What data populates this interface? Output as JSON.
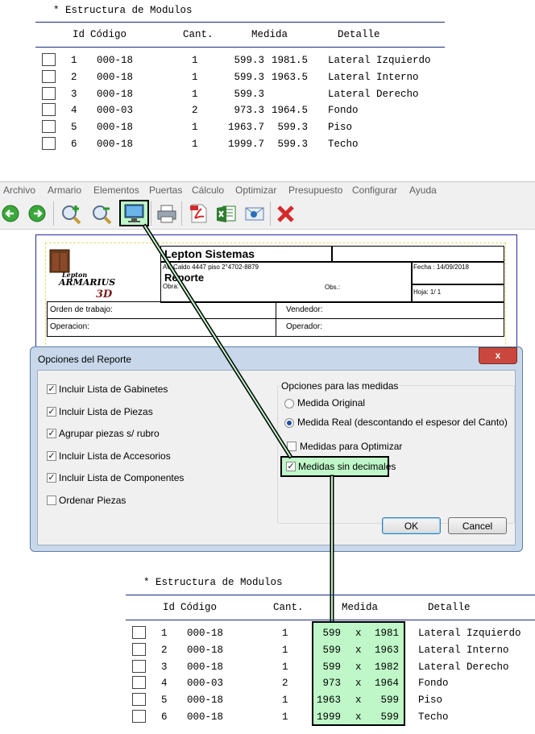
{
  "top_table": {
    "title": "* Estructura de Modulos",
    "headers": {
      "id": "Id",
      "codigo": "Código",
      "cant": "Cant.",
      "medida": "Medida",
      "detalle": "Detalle"
    },
    "rows": [
      {
        "id": "1",
        "codigo": "000-18",
        "cant": "1",
        "m1": "599.3",
        "m2": "1981.5",
        "detalle": "Lateral Izquierdo"
      },
      {
        "id": "2",
        "codigo": "000-18",
        "cant": "1",
        "m1": "599.3",
        "m2": "1963.5",
        "detalle": "Lateral Interno"
      },
      {
        "id": "3",
        "codigo": "000-18",
        "cant": "1",
        "m1": "599.3",
        "m2": "",
        "detalle": "Lateral Derecho"
      },
      {
        "id": "4",
        "codigo": "000-03",
        "cant": "2",
        "m1": "973.3",
        "m2": "1964.5",
        "detalle": "Fondo"
      },
      {
        "id": "5",
        "codigo": "000-18",
        "cant": "1",
        "m1": "1963.7",
        "m2": "599.3",
        "detalle": "Piso"
      },
      {
        "id": "6",
        "codigo": "000-18",
        "cant": "1",
        "m1": "1999.7",
        "m2": "599.3",
        "detalle": "Techo"
      }
    ]
  },
  "menu": [
    "Archivo",
    "Armario",
    "Elementos",
    "Puertas",
    "Cálculo",
    "Optimizar",
    "Presupuesto",
    "Configurar",
    "Ayuda"
  ],
  "toolbar": {
    "icons": [
      "back-arrow-icon",
      "forward-arrow-icon",
      "zoom-in-icon",
      "zoom-out-icon",
      "monitor-icon",
      "printer-icon",
      "pdf-icon",
      "excel-icon",
      "email-icon",
      "close-x-icon"
    ]
  },
  "report": {
    "company": "Lepton Sistemas",
    "address": "Av. Caldo 4447 piso 2°4702-8879",
    "title": "Reporte",
    "obra_label": "Obra:",
    "obs_label": "Obs.:",
    "fecha": "Fecha : 14/09/2018",
    "hoja": "Hoja: 1/ 1",
    "logo_text_1": "Lepton",
    "logo_text_2": "ARMARIUS",
    "logo_text_3": "3D",
    "orden_label": "Orden de trabajo:",
    "vendedor_label": "Vendedor:",
    "operacion_label": "Operacion:",
    "operador_label": "Operador:"
  },
  "dialog": {
    "title": "Opciones del Reporte",
    "close_glyph": "x",
    "left_options": [
      {
        "label": "Incluir Lista de Gabinetes",
        "checked": true
      },
      {
        "label": "Incluir Lista de Piezas",
        "checked": true
      },
      {
        "label": "Agrupar piezas s/ rubro",
        "checked": true
      },
      {
        "label": "Incluir Lista de Accesorios",
        "checked": true
      },
      {
        "label": "Incluir Lista de Componentes",
        "checked": true
      },
      {
        "label": "Ordenar Piezas",
        "checked": false
      }
    ],
    "group_title": "Opciones para las medidas",
    "radio_original": "Medida Original",
    "radio_real": "Medida Real (descontando el espesor del Canto)",
    "chk_optimizar": "Medidas para Optimizar",
    "chk_sin_decimales": "Medidas sin decimales",
    "ok": "OK",
    "cancel": "Cancel"
  },
  "bottom_table": {
    "title": "* Estructura de Modulos",
    "headers": {
      "id": "Id",
      "codigo": "Código",
      "cant": "Cant.",
      "medida": "Medida",
      "detalle": "Detalle"
    },
    "sep": "x",
    "rows": [
      {
        "id": "1",
        "codigo": "000-18",
        "cant": "1",
        "m1": "599",
        "m2": "1981",
        "detalle": "Lateral Izquierdo"
      },
      {
        "id": "2",
        "codigo": "000-18",
        "cant": "1",
        "m1": "599",
        "m2": "1963",
        "detalle": "Lateral Interno"
      },
      {
        "id": "3",
        "codigo": "000-18",
        "cant": "1",
        "m1": "599",
        "m2": "1982",
        "detalle": "Lateral Derecho"
      },
      {
        "id": "4",
        "codigo": "000-03",
        "cant": "2",
        "m1": "973",
        "m2": "1964",
        "detalle": "Fondo"
      },
      {
        "id": "5",
        "codigo": "000-18",
        "cant": "1",
        "m1": "1963",
        "m2": "599",
        "detalle": "Piso"
      },
      {
        "id": "6",
        "codigo": "000-18",
        "cant": "1",
        "m1": "1999",
        "m2": "599",
        "detalle": "Techo"
      }
    ]
  },
  "colors": {
    "highlight": "#bff7c8",
    "arrow": "#1a5e1a",
    "dialog_frame": "#c8d7ea",
    "close": "#c9473c"
  }
}
